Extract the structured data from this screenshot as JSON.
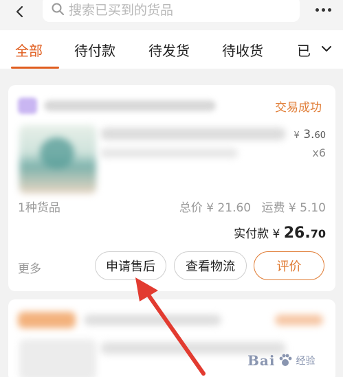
{
  "search": {
    "placeholder": "搜索已买到的货品"
  },
  "tabs": [
    {
      "label": "全部",
      "active": true
    },
    {
      "label": "待付款"
    },
    {
      "label": "待发货"
    },
    {
      "label": "待收货"
    },
    {
      "label": "已"
    }
  ],
  "order": {
    "status": "交易成功",
    "currency": "¥",
    "unit_price_int": "3.",
    "unit_price_dec": "60",
    "quantity": "x6",
    "item_count": "1种货品",
    "total_label": "总价 ¥ 21.60",
    "shipping_label": "运费 ¥ 5.10",
    "paid_prefix": "实付款 ¥ ",
    "paid_int": "26.",
    "paid_dec": "70",
    "more_label": "更多",
    "buttons": {
      "after_sale": "申请售后",
      "logistics": "查看物流",
      "review": "评价"
    }
  },
  "watermark": {
    "text": "Bai",
    "sub": "经验"
  },
  "colors": {
    "accent": "#e05d1e",
    "status": "#e07b33",
    "arrow": "#e23b30"
  }
}
